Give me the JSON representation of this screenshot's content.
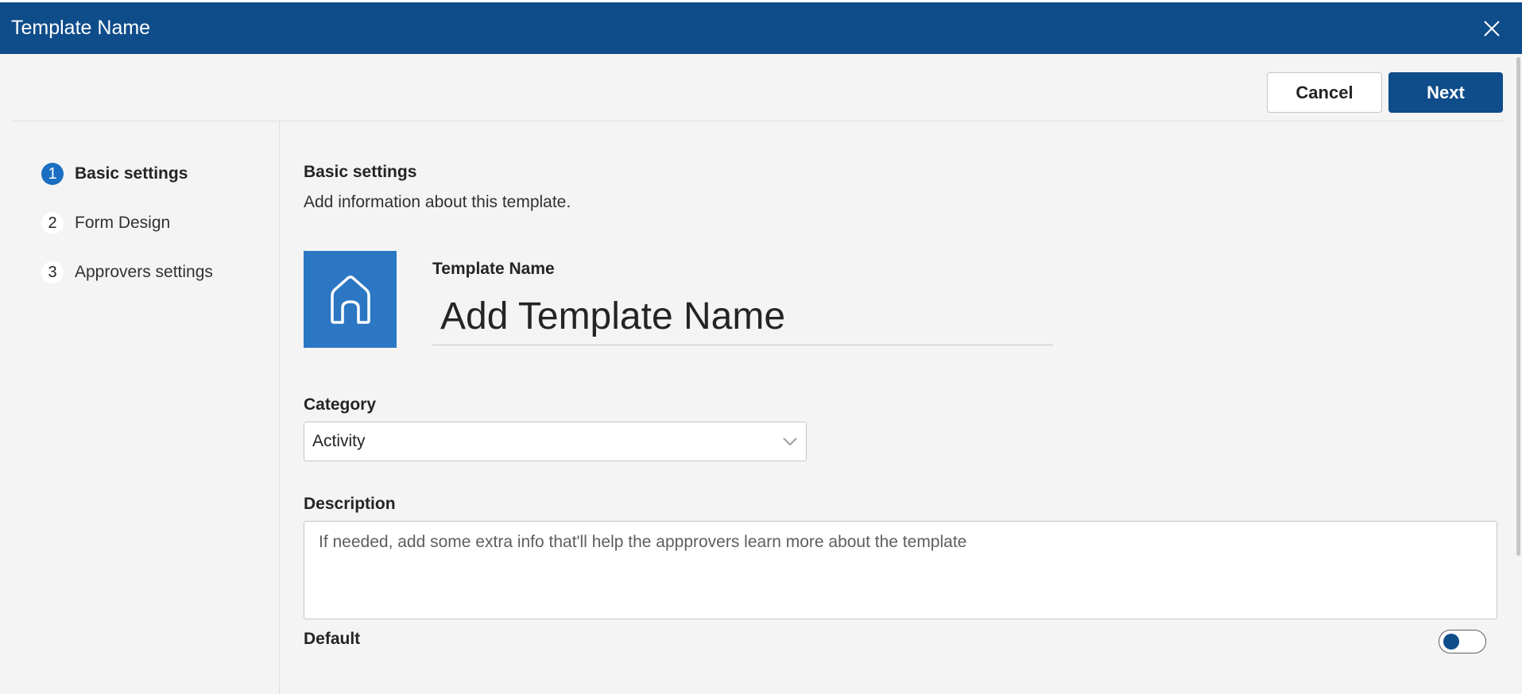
{
  "dialog": {
    "title": "Template Name",
    "close_icon": "close-icon"
  },
  "actions": {
    "cancel_label": "Cancel",
    "next_label": "Next"
  },
  "steps": [
    {
      "number": "1",
      "label": "Basic settings",
      "active": true
    },
    {
      "number": "2",
      "label": "Form Design",
      "active": false
    },
    {
      "number": "3",
      "label": "Approvers settings",
      "active": false
    }
  ],
  "basic": {
    "title": "Basic settings",
    "subtitle": "Add information about this template.",
    "template_icon": "home-icon",
    "template_name_label": "Template Name",
    "template_name_placeholder": "Add Template Name",
    "category_label": "Category",
    "category_value": "Activity",
    "description_label": "Description",
    "description_placeholder": "If needed, add some extra info that'll help the appprovers learn more about the template",
    "default_label": "Default",
    "default_on": false
  },
  "colors": {
    "header": "#0f4c8a",
    "accent": "#1b6ec2",
    "icon_tile": "#2b77c4",
    "background": "#f4f4f4"
  }
}
